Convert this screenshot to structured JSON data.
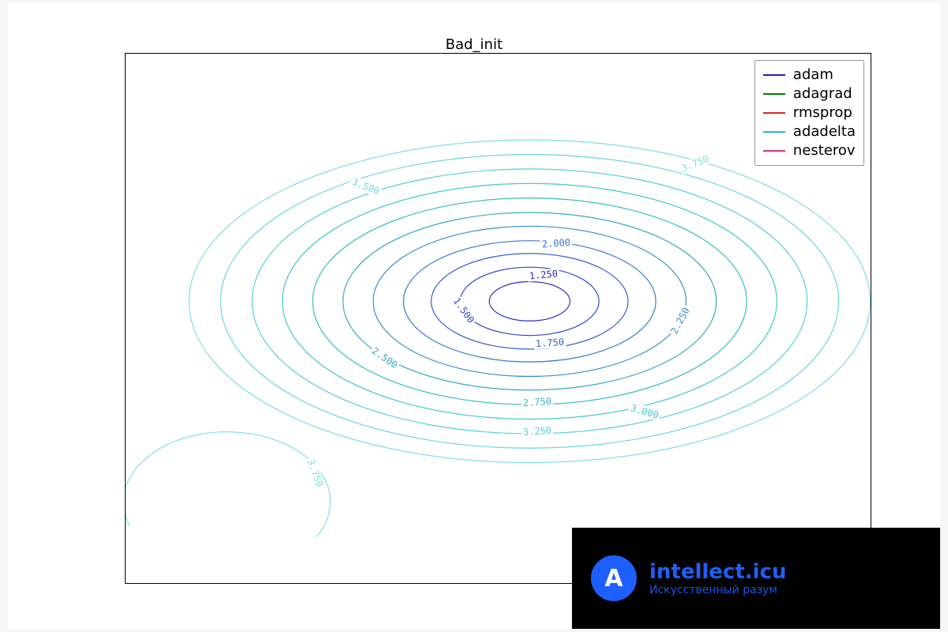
{
  "chart_data": {
    "type": "contour",
    "title": "Bad_init",
    "xlim": [
      -3.3,
      2.6
    ],
    "ylim": [
      -3.4,
      2.8
    ],
    "xticks": [
      -3,
      -2,
      -1,
      0,
      1,
      2
    ],
    "yticks": [
      -3,
      -2,
      -1,
      0,
      1,
      2
    ],
    "legend": [
      {
        "name": "adam",
        "color": "#1f1fbf"
      },
      {
        "name": "adagrad",
        "color": "#008000"
      },
      {
        "name": "rmsprop",
        "color": "#d62728"
      },
      {
        "name": "adadelta",
        "color": "#17becf"
      },
      {
        "name": "nesterov",
        "color": "#d63384"
      }
    ],
    "primary_center": [
      -0.1,
      -0.1
    ],
    "contours": [
      {
        "level": 1.25,
        "rx": 0.32,
        "ry": 0.23,
        "color": "#3030c8"
      },
      {
        "level": 1.5,
        "rx": 0.55,
        "ry": 0.4,
        "color": "#3348cc"
      },
      {
        "level": 1.75,
        "rx": 0.78,
        "ry": 0.56,
        "color": "#3560ce"
      },
      {
        "level": 2.0,
        "rx": 1.0,
        "ry": 0.71,
        "color": "#3678ce"
      },
      {
        "level": 2.25,
        "rx": 1.24,
        "ry": 0.88,
        "color": "#3790cc"
      },
      {
        "level": 2.5,
        "rx": 1.48,
        "ry": 1.04,
        "color": "#36a8c8"
      },
      {
        "level": 2.75,
        "rx": 1.72,
        "ry": 1.21,
        "color": "#33bec2"
      },
      {
        "level": 3.0,
        "rx": 1.96,
        "ry": 1.38,
        "color": "#42c8cf"
      },
      {
        "level": 3.25,
        "rx": 2.2,
        "ry": 1.55,
        "color": "#57cfd6"
      },
      {
        "level": 3.5,
        "rx": 2.45,
        "ry": 1.72,
        "color": "#6cd7dd"
      },
      {
        "level": 3.75,
        "rx": 2.7,
        "ry": 1.89,
        "color": "#7fdee3"
      }
    ],
    "secondary_arc": {
      "center": [
        -2.5,
        -2.45
      ],
      "r": 0.82,
      "start_deg": -30,
      "end_deg": 200,
      "level": 3.75,
      "color": "#7fdee3"
    },
    "contour_labels": [
      {
        "text": "1.250",
        "x": 0.0,
        "y": 0.22,
        "rot": -5,
        "color": "#3030c8"
      },
      {
        "text": "1.500",
        "x": -0.63,
        "y": -0.2,
        "rot": 55,
        "color": "#3348cc"
      },
      {
        "text": "1.750",
        "x": 0.05,
        "y": -0.58,
        "rot": -4,
        "color": "#3560ce"
      },
      {
        "text": "2.000",
        "x": 0.1,
        "y": 0.59,
        "rot": -4,
        "color": "#3678ce"
      },
      {
        "text": "2.250",
        "x": 1.08,
        "y": -0.32,
        "rot": -62,
        "color": "#3790cc"
      },
      {
        "text": "2.500",
        "x": -1.25,
        "y": -0.75,
        "rot": 35,
        "color": "#36a8c8"
      },
      {
        "text": "2.750",
        "x": -0.05,
        "y": -1.27,
        "rot": -4,
        "color": "#33bec2"
      },
      {
        "text": "3.000",
        "x": 0.8,
        "y": -1.38,
        "rot": 16,
        "color": "#42c8cf"
      },
      {
        "text": "3.250",
        "x": -0.05,
        "y": -1.61,
        "rot": -3,
        "color": "#57cfd6"
      },
      {
        "text": "3.500",
        "x": -1.4,
        "y": 1.25,
        "rot": 22,
        "color": "#6cd7dd"
      },
      {
        "text": "3.750",
        "x": 1.2,
        "y": 1.52,
        "rot": -22,
        "color": "#7fdee3"
      },
      {
        "text": "3.750",
        "x": -1.8,
        "y": -2.1,
        "rot": 70,
        "color": "#7fdee3"
      }
    ]
  },
  "watermark": {
    "logo_letter": "A",
    "line1": "intellect.icu",
    "line2": "Искусственный разум"
  }
}
